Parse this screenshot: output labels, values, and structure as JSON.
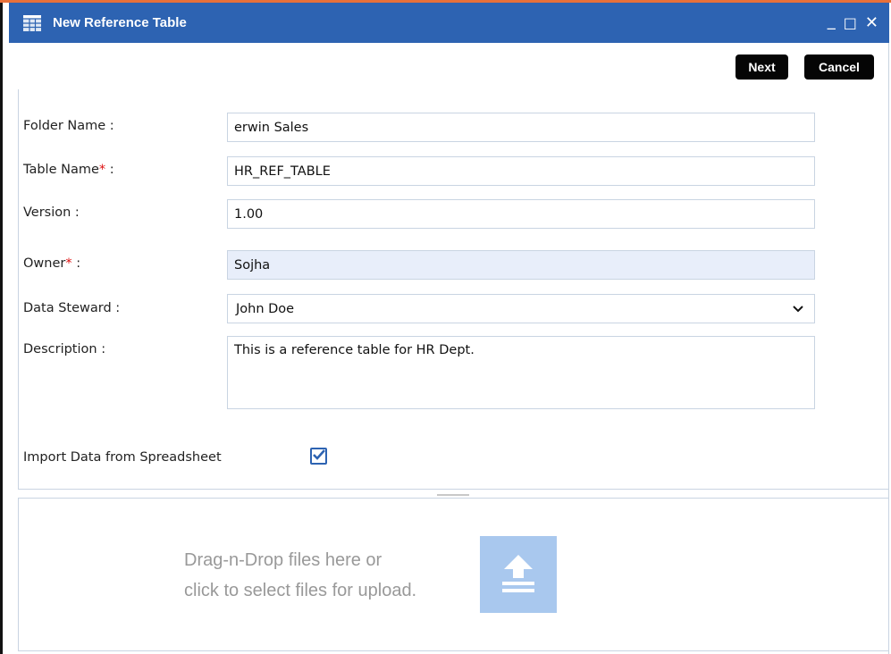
{
  "window": {
    "title": "New Reference Table",
    "controls": {
      "minimize": "_",
      "maximize": "□",
      "close": "✕"
    }
  },
  "toolbar": {
    "next_label": "Next",
    "cancel_label": "Cancel"
  },
  "form": {
    "folder_name": {
      "label": "Folder Name :",
      "value": "erwin Sales"
    },
    "table_name": {
      "label": "Table Name",
      "required_mark": "*",
      "suffix": " :",
      "value": "HR_REF_TABLE"
    },
    "version": {
      "label": "Version :",
      "value": "1.00"
    },
    "owner": {
      "label": "Owner",
      "required_mark": "*",
      "suffix": " :",
      "value": "Sojha"
    },
    "data_steward": {
      "label": "Data Steward :",
      "value": "John Doe"
    },
    "description": {
      "label": "Description :",
      "value": "This is a reference table for HR Dept."
    },
    "import_spreadsheet": {
      "label": "Import Data from Spreadsheet",
      "checked": true
    }
  },
  "upload": {
    "line1": "Drag-n-Drop files here or",
    "line2": "click to select files for upload."
  },
  "colors": {
    "titlebar": "#2d63b2",
    "button": "#050505",
    "owner_field_bg": "#e8eefa",
    "upload_icon_bg": "#a9c8ee",
    "required": "#dd1111",
    "top_accent": "#e8703a"
  },
  "icons": {
    "title": "table-icon",
    "dropdown": "chevron-down-icon",
    "checkbox": "checkmark-icon",
    "upload": "upload-icon"
  }
}
